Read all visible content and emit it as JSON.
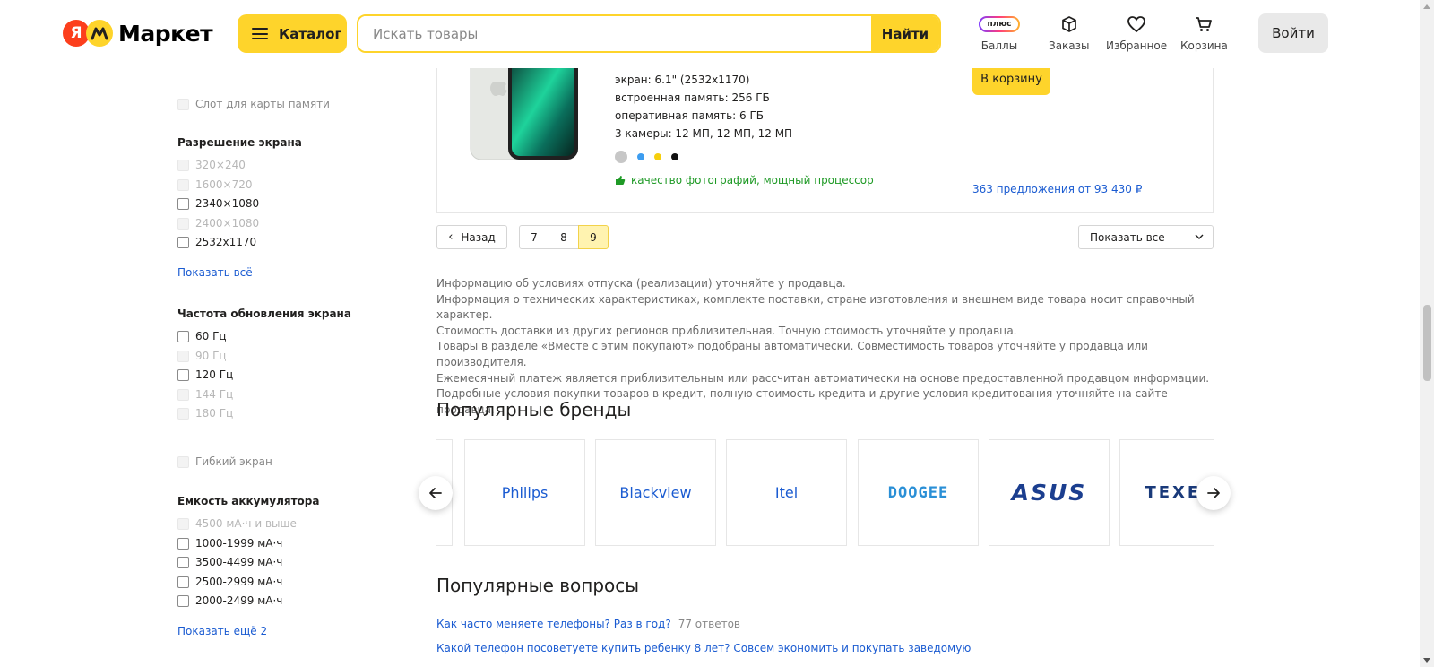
{
  "header": {
    "logo_ya": "Я",
    "logo_text": "Маркет",
    "catalog_label": "Каталог",
    "search_placeholder": "Искать товары",
    "search_button": "Найти",
    "plus_badge": "плюс",
    "nav": [
      {
        "label": "Баллы",
        "icon": "plus-points-icon"
      },
      {
        "label": "Заказы",
        "icon": "box-icon"
      },
      {
        "label": "Избранное",
        "icon": "heart-icon"
      },
      {
        "label": "Корзина",
        "icon": "cart-icon"
      }
    ],
    "login_label": "Войти"
  },
  "sidebar": {
    "memory_slot": {
      "label": "Слот для карты памяти",
      "disabled": true
    },
    "resolution": {
      "title": "Разрешение экрана",
      "options": [
        {
          "label": "320×240",
          "disabled": true
        },
        {
          "label": "1600×720",
          "disabled": true
        },
        {
          "label": "2340×1080",
          "disabled": false
        },
        {
          "label": "2400×1080",
          "disabled": true
        },
        {
          "label": "2532x1170",
          "disabled": false
        }
      ],
      "link": "Показать всё"
    },
    "refresh": {
      "title": "Частота обновления экрана",
      "options": [
        {
          "label": "60 Гц",
          "disabled": false
        },
        {
          "label": "90 Гц",
          "disabled": true
        },
        {
          "label": "120 Гц",
          "disabled": false
        },
        {
          "label": "144 Гц",
          "disabled": true
        },
        {
          "label": "180 Гц",
          "disabled": true
        }
      ]
    },
    "flexible": {
      "label": "Гибкий экран",
      "disabled": true
    },
    "battery": {
      "title": "Емкость аккумулятора",
      "options": [
        {
          "label": "4500 мА·ч и выше",
          "disabled": true
        },
        {
          "label": "1000-1999 мА·ч",
          "disabled": false
        },
        {
          "label": "3500-4499 мА·ч",
          "disabled": false
        },
        {
          "label": "2500-2999 мА·ч",
          "disabled": false
        },
        {
          "label": "2000-2499 мА·ч",
          "disabled": false
        }
      ],
      "link": "Показать ещё 2"
    }
  },
  "product": {
    "specs": [
      "экран: 6.1\" (2532x1170)",
      "встроенная память: 256 ГБ",
      "оперативная память: 6 ГБ",
      "3 камеры: 12 МП, 12 МП, 12 МП"
    ],
    "color_options": [
      "#c7c7c7",
      "#3d9df0",
      "#f6cf0d",
      "#111111"
    ],
    "feature": "качество фотографий, мощный процессор",
    "cart_button": "В корзину",
    "offers": "363 предложения от 93 430 ₽"
  },
  "pagination": {
    "back_label": "Назад",
    "pages": [
      "7",
      "8",
      "9"
    ],
    "active_page": "9",
    "show_all_label": "Показать все"
  },
  "disclaimer": [
    "Информацию об условиях отпуска (реализации) уточняйте у продавца.",
    "Информация о технических характеристиках, комплекте поставки, стране изготовления и внешнем виде товара носит справочный характер.",
    "Стоимость доставки из других регионов приблизительная. Точную стоимость уточняйте у продавца.",
    "Товары в разделе «Вместе с этим покупают» подобраны автоматически. Совместимость товаров уточняйте у продавца или производителя.",
    "Ежемесячный платеж является приблизительным или рассчитан автоматически на основе предоставленной продавцом информации. Подробные условия покупки товаров в кредит, полную стоимость кредита и другие условия кредитования уточняйте на сайте продавца."
  ],
  "brands": {
    "title": "Популярные бренды",
    "items": [
      "Philips",
      "Blackview",
      "Itel",
      "DOOGEE",
      "ASUS",
      "TEXET"
    ]
  },
  "questions": {
    "title": "Популярные вопросы",
    "items": [
      {
        "text": "Как часто меняете телефоны? Раз в год?",
        "count": "77 ответов"
      },
      {
        "text": "Какой телефон посоветуете купить ребенку 8 лет? Совсем экономить и покупать заведомую",
        "count": ""
      }
    ]
  }
}
